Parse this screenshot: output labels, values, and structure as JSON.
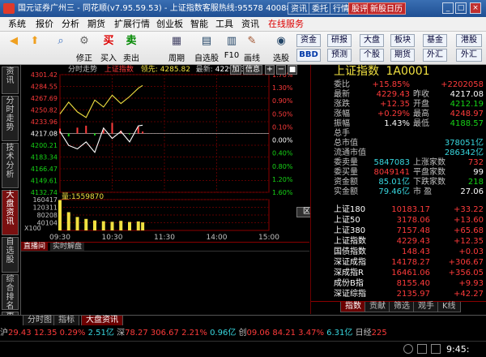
{
  "window": {
    "title": "国元证券广州三 - 同花顺(v7.95.59.53) - 上证指数客服热线:95578 4008888777",
    "title_buttons": [
      "资讯",
      "委托",
      "行情",
      "股评",
      "新股日历"
    ],
    "controls": [
      "_",
      "□",
      "×"
    ]
  },
  "menu": {
    "items": [
      "系统",
      "报价",
      "分析",
      "期货",
      "扩展行情",
      "创业板",
      "智能",
      "工具",
      "资讯"
    ],
    "online": "在线服务"
  },
  "toolbar": {
    "tools": [
      {
        "icon": "back-arrow-icon",
        "label": ""
      },
      {
        "icon": "up-arrow-icon",
        "label": ""
      },
      {
        "icon": "magnifier-icon",
        "label": ""
      },
      {
        "icon": "settings-icon",
        "label": "修正"
      },
      {
        "icon": "buy-icon",
        "label": "买入"
      },
      {
        "icon": "sell-icon",
        "label": "卖出"
      },
      {
        "icon": "grid-icon",
        "label": "周期"
      },
      {
        "icon": "watchlist-icon",
        "label": "自选股"
      },
      {
        "icon": "f10-icon",
        "label": "F10"
      },
      {
        "icon": "pencil-icon",
        "label": "画线"
      },
      {
        "icon": "select-icon",
        "label": "选股"
      }
    ],
    "right_buttons": [
      [
        "资金",
        "研报",
        "大盘",
        "板块",
        "基金",
        "港股"
      ],
      [
        "BBD",
        "预测",
        "个股",
        "期货",
        "外汇",
        "外汇"
      ]
    ]
  },
  "vtabs": [
    "资讯",
    "分时走势",
    "技术分析",
    "大盘资讯",
    "自选股",
    "综合排名",
    "更多"
  ],
  "chart": {
    "tab_label": "分时走势",
    "name": "上证指数",
    "lead_label": "领先:",
    "lead_value": "4285.82",
    "latest_label": "最新:",
    "latest_value": "4229.43",
    "btn_add": "加",
    "btn_info": "信息",
    "zoom_in": "+",
    "zoom_out": "−",
    "y_left_ticks": [
      "4301.42",
      "4284.55",
      "4267.69",
      "4250.82",
      "4233.96",
      "4217.08",
      "4200.21",
      "4183.34",
      "4166.47",
      "4149.61",
      "4132.74"
    ],
    "y_right_ticks": [
      "1.70%",
      "1.30%",
      "0.90%",
      "0.50%",
      "0.10%",
      "0.00%",
      "0.40%",
      "0.80%",
      "1.20%",
      "1.60%"
    ],
    "x_ticks": [
      "09:30",
      "10:30",
      "11:30",
      "14:00",
      "15:00"
    ],
    "volume_label": "量:",
    "volume_value": "1559870",
    "vol_ticks": [
      "160417",
      "120311",
      "80208",
      "40104"
    ],
    "vol_unit": "X100",
    "panel_btn": "区间"
  },
  "chart_data": {
    "type": "line",
    "x": [
      "09:30",
      "09:40",
      "09:50",
      "10:00",
      "10:10",
      "10:20",
      "10:30",
      "10:40",
      "10:50",
      "11:00",
      "11:05"
    ],
    "series": [
      {
        "name": "领先",
        "values": [
          4245,
          4262,
          4248,
          4240,
          4265,
          4255,
          4272,
          4260,
          4270,
          4282,
          4286
        ]
      },
      {
        "name": "最新",
        "values": [
          4220,
          4200,
          4195,
          4205,
          4190,
          4225,
          4210,
          4220,
          4205,
          4228,
          4229
        ]
      }
    ],
    "bars_pct": [
      0.5,
      -0.3,
      0.6,
      0.8,
      -0.2,
      0.4,
      1.1,
      0.3,
      -0.1,
      0.7,
      0.2
    ],
    "volume": [
      158000,
      95000,
      70000,
      60000,
      52000,
      48000,
      45000,
      50000,
      44000,
      47000,
      42000
    ],
    "ylim": [
      4132.74,
      4301.42
    ],
    "prev_close": 4217.08
  },
  "lower_tabs": [
    "直播间",
    "实时解盘"
  ],
  "quote": {
    "name": "上证指数",
    "code": "1A0001",
    "rows": [
      {
        "l": "委比",
        "v": "+15.85%",
        "vc": "r",
        "l2": "",
        "v2": "+2202058",
        "v2c": "r"
      },
      {
        "l": "最新",
        "v": "4229.43",
        "vc": "r",
        "l2": "昨收",
        "v2": "4217.08",
        "v2c": "wh"
      },
      {
        "l": "涨跌",
        "v": "+12.35",
        "vc": "r",
        "l2": "开盘",
        "v2": "4212.19",
        "v2c": "g"
      },
      {
        "l": "涨幅",
        "v": "+0.29%",
        "vc": "r",
        "l2": "最高",
        "v2": "4248.97",
        "v2c": "r"
      },
      {
        "l": "振幅",
        "v": "1.43%",
        "vc": "wh",
        "l2": "最低",
        "v2": "4188.57",
        "v2c": "g"
      },
      {
        "l": "总手",
        "v": "",
        "vc": "y",
        "l2": "",
        "v2": "",
        "v2c": "y"
      },
      {
        "l": "总市值",
        "v": "",
        "vc": "y",
        "l2": "",
        "v2": "378051亿",
        "v2c": "c"
      },
      {
        "l": "流通市值",
        "v": "",
        "vc": "y",
        "l2": "",
        "v2": "286342亿",
        "v2c": "c"
      }
    ],
    "stats": [
      {
        "l": "委卖量",
        "v": "5847083",
        "vc": "c",
        "l2": "上涨家数",
        "v2": "732",
        "v2c": "r"
      },
      {
        "l": "委买量",
        "v": "8049141",
        "vc": "r",
        "l2": "平盘家数",
        "v2": "99",
        "v2c": "wh"
      },
      {
        "l": "资金额",
        "v": "85.01亿",
        "vc": "c",
        "l2": "下跌家数",
        "v2": "218",
        "v2c": "g"
      },
      {
        "l": "实金额",
        "v": "79.46亿",
        "vc": "c",
        "l2": "市 盈",
        "v2": "27.06",
        "v2c": "wh"
      }
    ],
    "indices": [
      {
        "n": "上证180",
        "v": "10183.17",
        "c": "+33.22"
      },
      {
        "n": "上证50",
        "v": "3178.06",
        "c": "+13.60"
      },
      {
        "n": "上证380",
        "v": "7157.48",
        "c": "+65.68"
      },
      {
        "n": "上证指数",
        "v": "4229.43",
        "c": "+12.35"
      },
      {
        "n": "国债指数",
        "v": "148.43",
        "c": "+0.03"
      },
      {
        "n": "深证成指",
        "v": "14178.27",
        "c": "+306.67"
      },
      {
        "n": "深成指R",
        "v": "16461.06",
        "c": "+356.05"
      },
      {
        "n": "成份B指",
        "v": "8155.40",
        "c": "+9.93"
      },
      {
        "n": "深证综指",
        "v": "2135.97",
        "c": "+42.27"
      }
    ],
    "right_tabs": [
      "指数",
      "贡献",
      "筛选",
      "观手",
      "K线"
    ]
  },
  "bottom_tabs": [
    "分时图",
    "指标",
    "大盘资讯"
  ],
  "ticker": {
    "sh_label": "沪",
    "sh": "29.43",
    "sh2": "12.35",
    "sh_pct": "0.29%",
    "sh_amt": "2.51亿",
    "sz_label": "深",
    "sz": "78.27",
    "sz2": "306.67",
    "sz_pct": "2.21%",
    "sz_amt": "0.96亿",
    "cy_label": "创",
    "cy": "09.06",
    "cy2": "84.21",
    "cy_pct": "3.47%",
    "cy_amt": "6.31亿",
    "extra_label": "日经",
    "extra_value": "225"
  },
  "status": {
    "time": "9:45:"
  }
}
